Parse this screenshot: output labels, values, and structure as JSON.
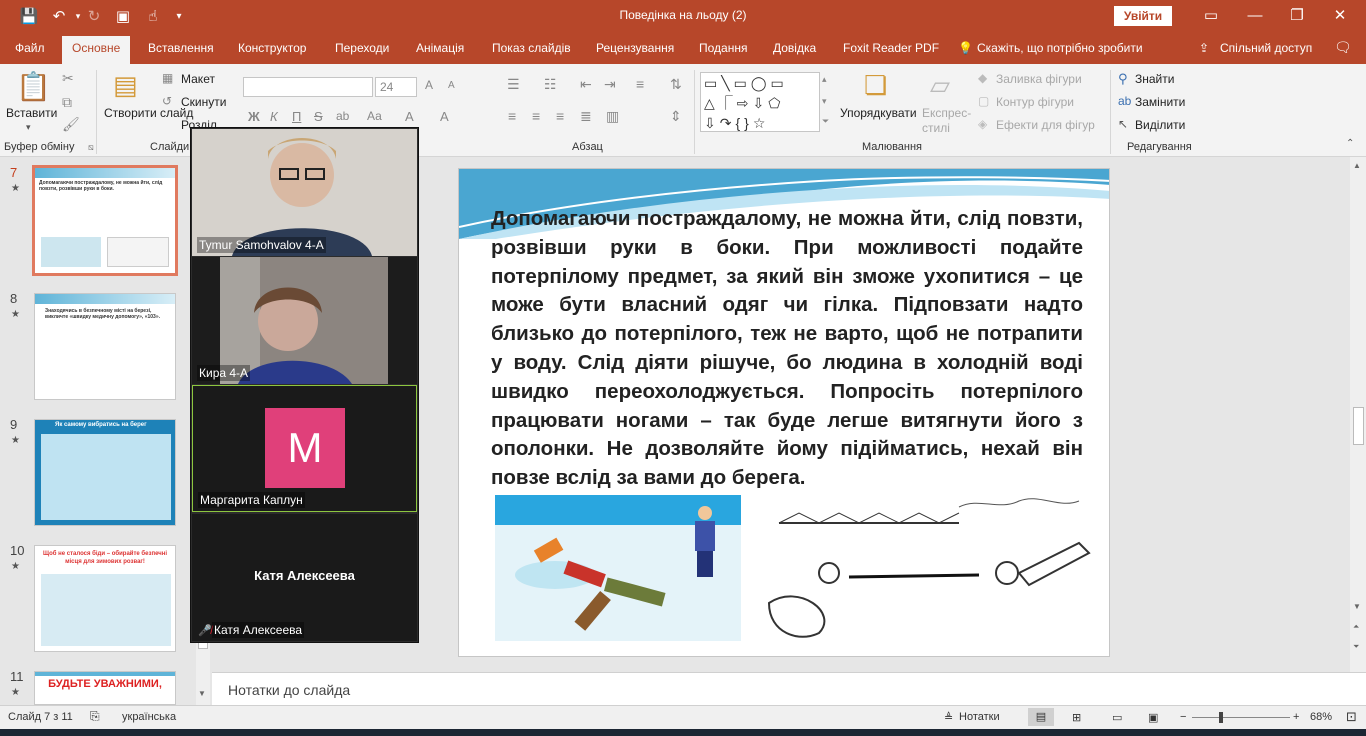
{
  "window": {
    "title": "Поведінка на льоду (2)",
    "signin_label": "Увійти"
  },
  "tabs": [
    {
      "label": "Файл"
    },
    {
      "label": "Основне"
    },
    {
      "label": "Вставлення"
    },
    {
      "label": "Конструктор"
    },
    {
      "label": "Переходи"
    },
    {
      "label": "Анімація"
    },
    {
      "label": "Показ слайдів"
    },
    {
      "label": "Рецензування"
    },
    {
      "label": "Подання"
    },
    {
      "label": "Довідка"
    },
    {
      "label": "Foxit Reader PDF"
    },
    {
      "label": "Скажіть, що потрібно зробити"
    },
    {
      "label": "Спільний доступ"
    }
  ],
  "ribbon": {
    "paste_label": "Вставити",
    "clipboard_group": "Буфер обміну",
    "new_slide_label": "Створити слайд",
    "layout_label": "Макет",
    "reset_label": "Скинути",
    "section_label": "Розділ",
    "slides_group": "Слайди",
    "font_size": "24",
    "paragraph_group": "Абзац",
    "arrange_label": "Упорядкувати",
    "quick_styles_label": "Експрес-стилі",
    "shape_fill_label": "Заливка фігури",
    "shape_outline_label": "Контур фігури",
    "shape_effects_label": "Ефекти для фігур",
    "drawing_group": "Малювання",
    "find_label": "Знайти",
    "replace_label": "Замінити",
    "select_label": "Виділити",
    "editing_group": "Редагування"
  },
  "thumbnails": [
    {
      "num": "7",
      "star": "★",
      "text": "Допомагаючи постраждалому, не можна йти, слід повзти, розвівши руки в боки."
    },
    {
      "num": "8",
      "star": "★",
      "text": "Знаходячись в безпечному місті на березі, викличте «швидку медичну допомогу», «103»."
    },
    {
      "num": "9",
      "star": "★",
      "text": "Як самому вибратись на берег"
    },
    {
      "num": "10",
      "star": "★",
      "text": "Щоб не сталося біди – обирайте безпечні місця для зимових розваг!"
    },
    {
      "num": "11",
      "star": "★",
      "text": "БУДЬТЕ УВАЖНИМИ,"
    }
  ],
  "participants": [
    {
      "name": "Tymur Samohvalov 4-А"
    },
    {
      "name": "Кира 4-А"
    },
    {
      "name": "Маргарита Каплун",
      "initial": "M"
    },
    {
      "name": "Катя Алексеева",
      "big_name": "Катя Алексеева"
    }
  ],
  "slide": {
    "body": "Допомагаючи постраждалому, не можна йти, слід повзти, розвівши руки в боки. При можливості подайте потерпілому предмет, за який він зможе ухопитися – це може бути власний одяг чи гілка. Підповзати надто  близько до потерпілого, теж не варто, щоб не потрапити у воду. Слід діяти рішуче, бо людина в холодній воді швидко переохолоджується. Попросіть потерпілого працювати ногами – так буде легше витягнути його з ополонки. Не дозволяйте йому підійматись, нехай він повзе  вслід за вами до берега."
  },
  "notes_placeholder": "Нотатки до слайда",
  "status": {
    "slide_of": "Слайд 7 з 11",
    "language": "українська",
    "notes_label": "Нотатки",
    "zoom": "68%"
  }
}
